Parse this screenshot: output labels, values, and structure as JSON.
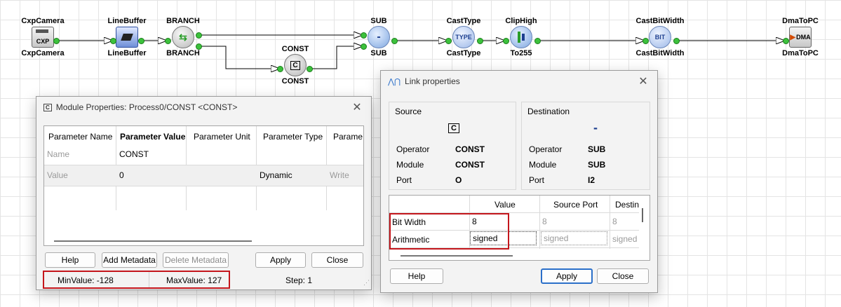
{
  "graph": {
    "nodes": [
      {
        "id": "cxp",
        "top": "CxpCamera",
        "bottom": "CxpCamera",
        "icon": "CXP"
      },
      {
        "id": "linebuffer",
        "top": "LineBuffer",
        "bottom": "LineBuffer",
        "icon": "linebuffer-icon"
      },
      {
        "id": "branch",
        "top": "BRANCH",
        "bottom": "BRANCH",
        "icon": "branch-icon"
      },
      {
        "id": "const",
        "top": "CONST",
        "bottom": "CONST",
        "icon": "C"
      },
      {
        "id": "sub",
        "top": "SUB",
        "bottom": "SUB",
        "icon": "-"
      },
      {
        "id": "casttype",
        "top": "CastType",
        "bottom": "CastType",
        "icon": "TYPE"
      },
      {
        "id": "cliphigh",
        "top": "ClipHigh",
        "bottom": "To255",
        "icon": "cliphigh-icon"
      },
      {
        "id": "castbitwidth",
        "top": "CastBitWidth",
        "bottom": "CastBitWidth",
        "icon": "BIT"
      },
      {
        "id": "dmatopc",
        "top": "DmaToPC",
        "bottom": "DmaToPC",
        "icon": "DMA"
      }
    ]
  },
  "module_properties": {
    "title": "Module Properties: Process0/CONST <CONST>",
    "columns": [
      "Parameter Name",
      "Parameter Value",
      "Parameter Unit",
      "Parameter Type",
      "Parame"
    ],
    "rows": [
      {
        "name": "Name",
        "value": "CONST",
        "unit": "",
        "type": "",
        "access": ""
      },
      {
        "name": "Value",
        "value": "0",
        "unit": "",
        "type": "Dynamic",
        "access": "Write"
      }
    ],
    "buttons": {
      "help": "Help",
      "add_metadata": "Add Metadata",
      "delete_metadata": "Delete Metadata",
      "apply": "Apply",
      "close": "Close"
    },
    "status": {
      "min": "MinValue: -128",
      "max": "MaxValue: 127",
      "step": "Step: 1"
    }
  },
  "link_properties": {
    "title": "Link properties",
    "source": {
      "header": "Source",
      "icon": "C",
      "operator_label": "Operator",
      "operator": "CONST",
      "module_label": "Module",
      "module": "CONST",
      "port_label": "Port",
      "port": "O"
    },
    "destination": {
      "header": "Destination",
      "icon": "-",
      "operator_label": "Operator",
      "operator": "SUB",
      "module_label": "Module",
      "module": "SUB",
      "port_label": "Port",
      "port": "I2"
    },
    "columns": [
      "",
      "Value",
      "Source Port",
      "Destin"
    ],
    "rows": [
      {
        "name": "Bit Width",
        "value": "8",
        "source": "8",
        "dest": "8"
      },
      {
        "name": "Arithmetic",
        "value": "signed",
        "source": "signed",
        "dest": "signed"
      }
    ],
    "buttons": {
      "help": "Help",
      "apply": "Apply",
      "close": "Close"
    }
  }
}
